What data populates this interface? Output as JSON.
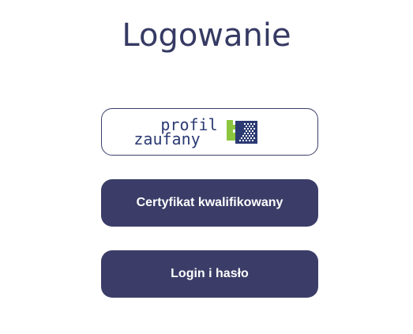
{
  "page": {
    "title": "Logowanie"
  },
  "login_options": {
    "profil_zaufany": {
      "logo_line1": "profil",
      "logo_line2": "zaufany",
      "icon": "profil-zaufany-emblem-icon"
    },
    "certificate_label": "Certyfikat kwalifikowany",
    "login_password_label": "Login i hasło"
  },
  "colors": {
    "title": "#363a63",
    "button_dark": "#3b3d68",
    "logo_navy": "#2b3a73",
    "logo_green": "#8cc63f"
  }
}
